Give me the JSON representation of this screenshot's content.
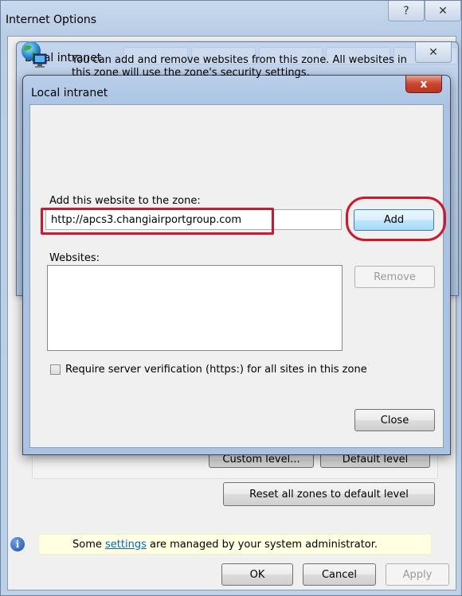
{
  "internet_options": {
    "title": "Internet Options",
    "help_glyph": "?",
    "close_glyph": "✕",
    "custom_level_label": "Custom level...",
    "default_level_label": "Default level",
    "reset_label": "Reset all zones to default level",
    "info_prefix": "Some ",
    "info_link": "settings",
    "info_suffix": " are managed by your system administrator.",
    "info_glyph": "i",
    "ok_label": "OK",
    "cancel_label": "Cancel",
    "apply_label": "Apply"
  },
  "local_intranet_window": {
    "title": "Local intranet",
    "close_glyph": "✕"
  },
  "dialog": {
    "title": "Local intranet",
    "close_glyph": "x",
    "intro": "You can add and remove websites from this zone. All websites in this zone will use the zone's security settings.",
    "add_label": "Add this website to the zone:",
    "url_value": "http://apcs3.changiairportgroup.com",
    "add_button": "Add",
    "websites_label": "Websites:",
    "remove_button": "Remove",
    "websites": [],
    "https_label": "Require server verification (https:) for all sites in this zone",
    "https_checked": false,
    "close_button": "Close",
    "highlight_color": "#d2162b",
    "icon": "globe-computer-icon"
  }
}
